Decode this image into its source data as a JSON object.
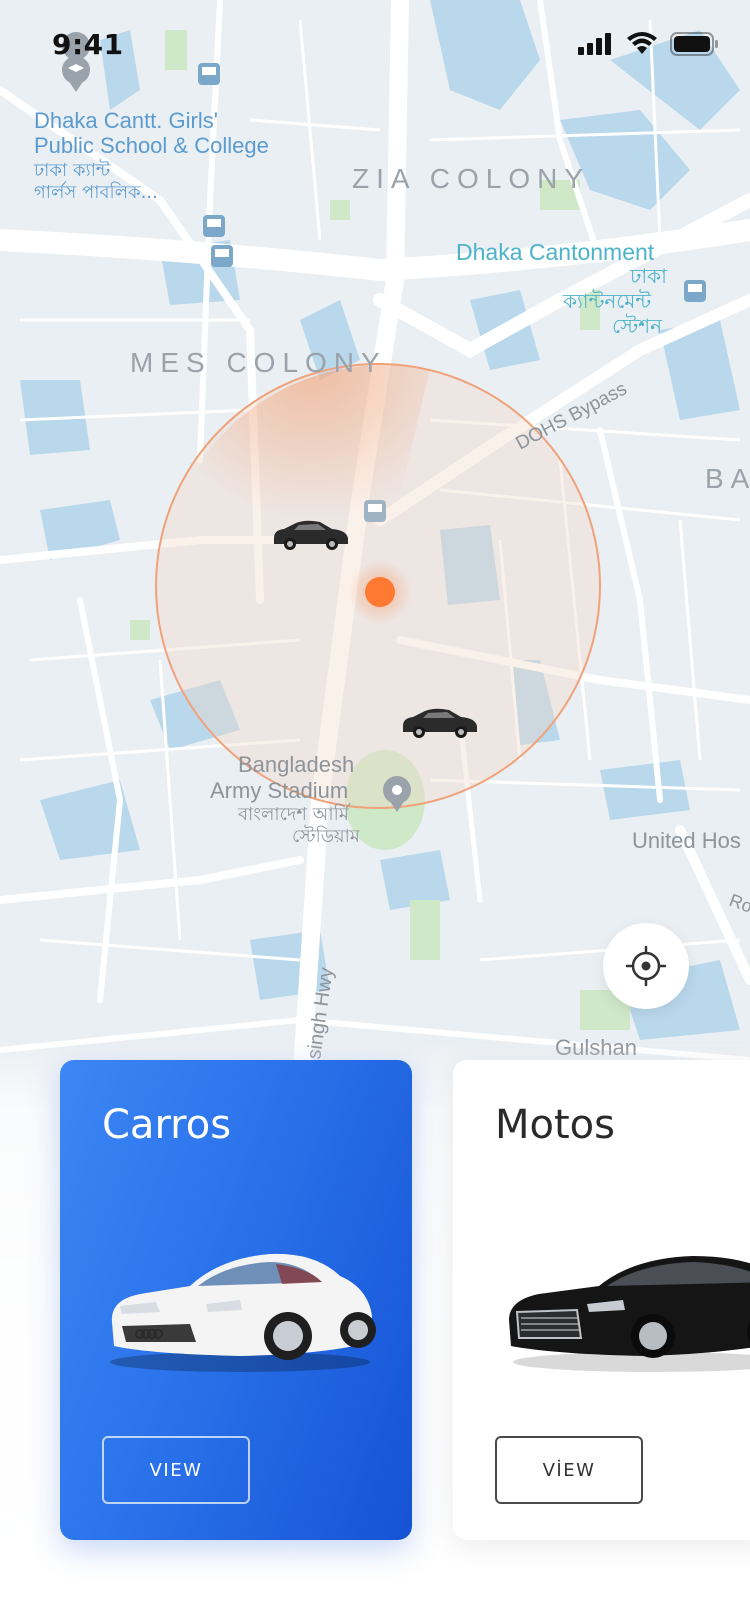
{
  "status_bar": {
    "time": "9:41"
  },
  "map": {
    "labels": {
      "school_en_1": "Dhaka Cantt. Girls'",
      "school_en_2": "Public School & College",
      "school_bn_1": "ঢাকা ক্যান্ট",
      "school_bn_2": "গার্লস পাবলিক...",
      "zia_colony": "ZIA COLONY",
      "mes_colony": "MES COLONY",
      "cantonment_en": "Dhaka Cantonment",
      "cantonment_bn_1": "ঢাকা",
      "cantonment_bn_2": "ক্যান্টনমেন্ট",
      "cantonment_bn_3": "স্টেশন",
      "dohs_bypass": "DOHS Bypass",
      "ba_partial": "BA",
      "stadium_en_1": "Bangladesh",
      "stadium_en_2": "Army Stadium",
      "stadium_bn_1": "বাংলাদেশ আর্মি",
      "stadium_bn_2": "স্টেডিয়াম",
      "united_hospital": "United Hos",
      "singh_hwy": "singh Hwy",
      "gulshan": "Gulshan",
      "ro_partial": "Ro"
    },
    "colors": {
      "radius_fill": "#f08a55",
      "user_dot": "#ff7a30"
    }
  },
  "locate_button": {
    "icon": "crosshair-icon"
  },
  "categories": [
    {
      "title": "Carros",
      "button_label": "VIEW",
      "image": "white-coupe-car",
      "accent": "#2a72ea"
    },
    {
      "title": "Motos",
      "button_label": "VİEW",
      "image": "black-sedan-car",
      "accent": "#ffffff"
    }
  ]
}
